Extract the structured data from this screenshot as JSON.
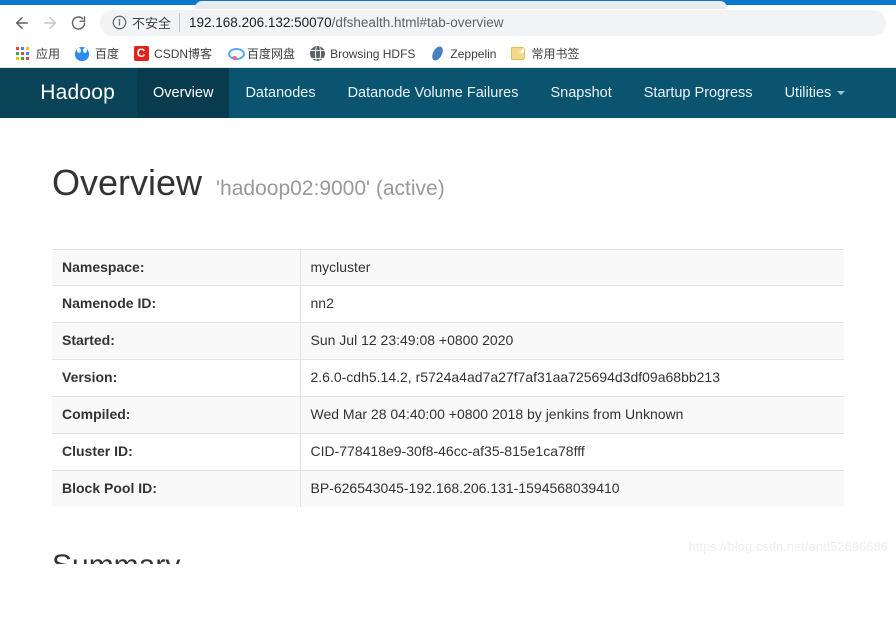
{
  "browser": {
    "back_icon": "back-arrow-icon",
    "forward_icon": "forward-arrow-icon",
    "reload_icon": "reload-icon",
    "security_label": "不安全",
    "url_host": "192.168.206.132:50070",
    "url_path": "/dfshealth.html#tab-overview",
    "url_full": "192.168.206.132:50070/dfshealth.html#tab-overview",
    "tab_strip_color": "#0c78cc",
    "bookmarks": [
      {
        "label": "应用",
        "icon": "apps-grid-icon"
      },
      {
        "label": "百度",
        "icon": "baidu-icon"
      },
      {
        "label": "CSDN博客",
        "icon": "csdn-icon",
        "glyph": "C"
      },
      {
        "label": "百度网盘",
        "icon": "baidu-pan-icon"
      },
      {
        "label": "Browsing HDFS",
        "icon": "globe-icon"
      },
      {
        "label": "Zeppelin",
        "icon": "zeppelin-icon"
      },
      {
        "label": "常用书签",
        "icon": "folder-icon"
      }
    ]
  },
  "navbar": {
    "brand": "Hadoop",
    "background_color": "#0b5470",
    "active_color": "#073b4d",
    "items": [
      {
        "label": "Overview",
        "active": true,
        "caret": false
      },
      {
        "label": "Datanodes",
        "active": false,
        "caret": false
      },
      {
        "label": "Datanode Volume Failures",
        "active": false,
        "caret": false
      },
      {
        "label": "Snapshot",
        "active": false,
        "caret": false
      },
      {
        "label": "Startup Progress",
        "active": false,
        "caret": false
      },
      {
        "label": "Utilities",
        "active": false,
        "caret": true
      }
    ]
  },
  "overview": {
    "title": "Overview",
    "subtitle": "'hadoop02:9000' (active)",
    "rows": [
      {
        "label": "Namespace:",
        "value": "mycluster"
      },
      {
        "label": "Namenode ID:",
        "value": "nn2"
      },
      {
        "label": "Started:",
        "value": "Sun Jul 12 23:49:08 +0800 2020"
      },
      {
        "label": "Version:",
        "value": "2.6.0-cdh5.14.2, r5724a4ad7a27f7af31aa725694d3df09a68bb213"
      },
      {
        "label": "Compiled:",
        "value": "Wed Mar 28 04:40:00 +0800 2018 by jenkins from Unknown"
      },
      {
        "label": "Cluster ID:",
        "value": "CID-778418e9-30f8-46cc-af35-815e1ca78fff"
      },
      {
        "label": "Block Pool ID:",
        "value": "BP-626543045-192.168.206.131-1594568039410"
      }
    ]
  },
  "summary": {
    "title": "Summary"
  },
  "watermark": {
    "text": "https://blog.csdn.net/and52696686"
  }
}
